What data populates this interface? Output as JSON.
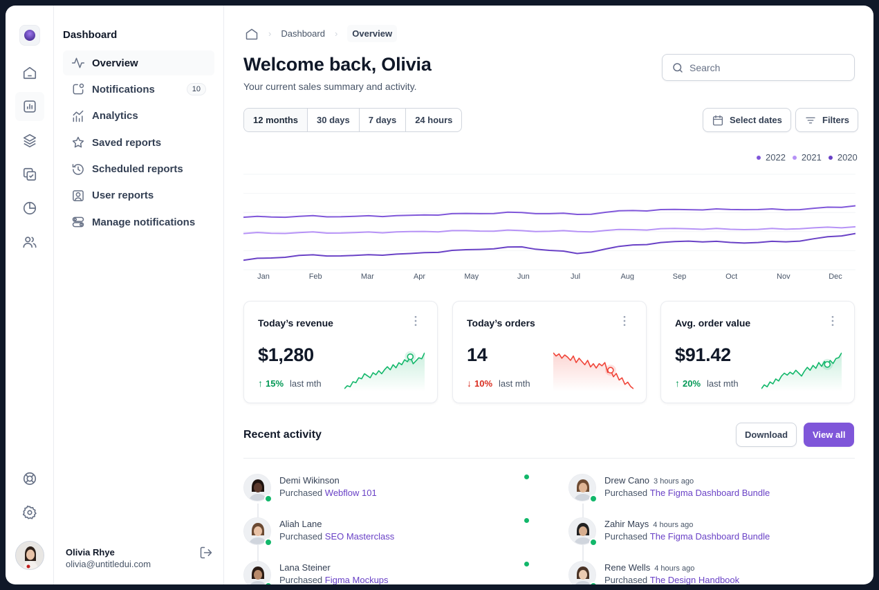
{
  "sidebar": {
    "title": "Dashboard",
    "items": [
      {
        "label": "Overview",
        "badge": "",
        "icon": "activity-icon"
      },
      {
        "label": "Notifications",
        "badge": "10",
        "icon": "notification-icon"
      },
      {
        "label": "Analytics",
        "badge": "",
        "icon": "analytics-icon"
      },
      {
        "label": "Saved reports",
        "badge": "",
        "icon": "star-icon"
      },
      {
        "label": "Scheduled reports",
        "badge": "",
        "icon": "clock-rewind-icon"
      },
      {
        "label": "User reports",
        "badge": "",
        "icon": "user-square-icon"
      },
      {
        "label": "Manage notifications",
        "badge": "",
        "icon": "toggles-icon"
      }
    ],
    "user": {
      "name": "Olivia Rhye",
      "email": "olivia@untitledui.com"
    }
  },
  "breadcrumb": {
    "parent": "Dashboard",
    "current": "Overview"
  },
  "header": {
    "title": "Welcome back, Olivia",
    "subtitle": "Your current sales summary and activity.",
    "search_placeholder": "Search"
  },
  "range_tabs": [
    "12 months",
    "30 days",
    "7 days",
    "24 hours"
  ],
  "active_range": "12 months",
  "buttons": {
    "select_dates": "Select dates",
    "filters": "Filters",
    "download": "Download",
    "view_all": "View all"
  },
  "chart_data": {
    "type": "line",
    "x": [
      "Jan",
      "Feb",
      "Mar",
      "Apr",
      "May",
      "Jun",
      "Jul",
      "Aug",
      "Sep",
      "Oct",
      "Nov",
      "Dec"
    ],
    "series": [
      {
        "name": "2022",
        "color": "#7f56d9",
        "values": [
          55,
          56,
          56,
          57,
          59,
          60,
          58,
          62,
          63,
          63,
          63,
          67
        ]
      },
      {
        "name": "2021",
        "color": "#b692f6",
        "values": [
          38,
          39,
          39,
          40,
          41,
          41,
          40,
          42,
          43,
          42,
          43,
          45
        ]
      },
      {
        "name": "2020",
        "color": "#6941c6",
        "values": [
          10,
          15,
          15,
          17,
          21,
          24,
          17,
          26,
          30,
          28,
          30,
          38
        ]
      }
    ],
    "ylim": [
      0,
      100
    ],
    "grid": true,
    "legend": "top-right"
  },
  "cards": [
    {
      "title": "Today’s revenue",
      "value": "$1,280",
      "delta": "15%",
      "direction": "up",
      "period": "last mth",
      "trend": [
        8,
        14,
        12,
        22,
        20,
        30,
        28,
        38,
        34,
        30,
        40,
        36,
        44,
        38,
        46,
        52,
        46,
        56,
        50,
        60,
        56,
        66,
        62,
        72,
        58,
        64,
        70,
        68,
        80
      ]
    },
    {
      "title": "Today’s orders",
      "value": "14",
      "delta": "10%",
      "direction": "down",
      "period": "last mth",
      "trend": [
        80,
        74,
        78,
        70,
        76,
        72,
        66,
        74,
        62,
        70,
        64,
        58,
        66,
        54,
        60,
        52,
        60,
        56,
        62,
        44,
        48,
        36,
        42,
        30,
        34,
        22,
        26,
        18,
        14
      ]
    },
    {
      "title": "Avg. order value",
      "value": "$91.42",
      "delta": "20%",
      "direction": "up",
      "period": "last mth",
      "trend": [
        8,
        16,
        12,
        22,
        18,
        28,
        24,
        34,
        40,
        36,
        42,
        38,
        46,
        40,
        34,
        44,
        52,
        46,
        56,
        50,
        62,
        54,
        64,
        58,
        66,
        60,
        70,
        72,
        82
      ]
    }
  ],
  "activity": {
    "title": "Recent activity",
    "items": [
      {
        "name": "Demi Wikinson",
        "time": "",
        "action": "Purchased",
        "item": "Webflow 101",
        "skin": "#5b3a2e",
        "hair": "#1e130f"
      },
      {
        "name": "Aliah Lane",
        "time": "",
        "action": "Purchased",
        "item": "SEO Masterclass",
        "skin": "#e9c2a6",
        "hair": "#6b4a33"
      },
      {
        "name": "Lana Steiner",
        "time": "",
        "action": "Purchased",
        "item": "Figma Mockups",
        "skin": "#b98a6a",
        "hair": "#2a1b14"
      },
      {
        "name": "Drew Cano",
        "time": "3 hours ago",
        "action": "Purchased",
        "item": "The Figma Dashboard Bundle",
        "skin": "#dfb595",
        "hair": "#6e4b32"
      },
      {
        "name": "Zahir Mays",
        "time": "4 hours ago",
        "action": "Purchased",
        "item": "The Figma Dashboard Bundle",
        "skin": "#d7ae8f",
        "hair": "#222222"
      },
      {
        "name": "Rene Wells",
        "time": "4 hours ago",
        "action": "Purchased",
        "item": "The Design Handbook",
        "skin": "#eccbb1",
        "hair": "#4a3325"
      }
    ]
  }
}
